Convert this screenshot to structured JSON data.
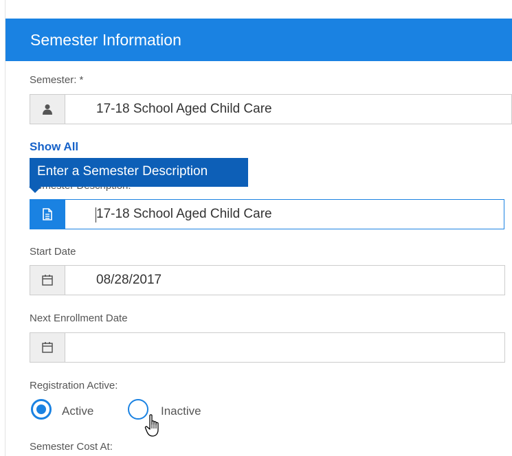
{
  "panel": {
    "title": "Semester Information"
  },
  "semester": {
    "label": "Semester: *",
    "value": "17-18 School Aged Child Care",
    "icon": "user-icon"
  },
  "show_all": "Show All",
  "description": {
    "label": "Semester Description:",
    "value": "17-18 School Aged Child Care",
    "tooltip": "Enter a Semester Description",
    "icon": "document-icon"
  },
  "start_date": {
    "label": "Start Date",
    "value": "08/28/2017",
    "icon": "calendar-icon"
  },
  "next_enrollment": {
    "label": "Next Enrollment Date",
    "value": "",
    "icon": "calendar-icon"
  },
  "registration": {
    "label": "Registration Active:",
    "options": [
      {
        "label": "Active",
        "selected": true
      },
      {
        "label": "Inactive",
        "selected": false
      }
    ]
  },
  "cost": {
    "label": "Semester Cost At:"
  },
  "colors": {
    "accent": "#1a82e2",
    "tooltip": "#0d5fb7",
    "link": "#1662c9"
  }
}
